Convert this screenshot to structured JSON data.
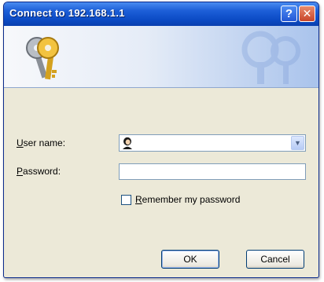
{
  "window": {
    "title": "Connect to 192.168.1.1",
    "help_button_label": "?",
    "close_button_label": "✕"
  },
  "form": {
    "username_label_accesskey": "U",
    "username_label_rest": "ser name:",
    "username_value": "",
    "password_label_accesskey": "P",
    "password_label_rest": "assword:",
    "password_value": "",
    "remember_label_accesskey": "R",
    "remember_label_rest": "emember my password",
    "remember_checked": false,
    "combo_arrow": "▼"
  },
  "buttons": {
    "ok_label": "OK",
    "cancel_label": "Cancel"
  },
  "icons": {
    "banner": "keys-icon",
    "watermark": "keys-watermark-icon",
    "username": "user-icon"
  },
  "colors": {
    "titlebar": "#0b4ac4",
    "dialog_background": "#ece9d8",
    "field_border": "#7f9db9",
    "close_button": "#c8452a"
  }
}
